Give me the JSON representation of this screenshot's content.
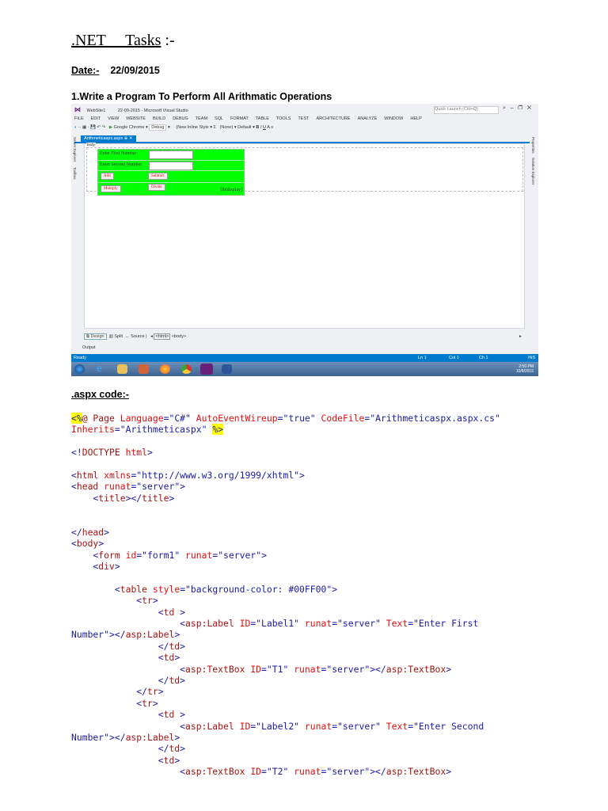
{
  "doc": {
    "title": ".NET     Tasks",
    "title_suffix": " :-",
    "date_label": "Date:-",
    "date_value": "22/09/2015",
    "task": "1.Write a Program To Perform All Arithmatic Operations",
    "code_heading": ".aspx  code:-"
  },
  "vs": {
    "project": "WebSite1",
    "window_title": "22-09-2015 - Microsoft Visual Studio",
    "quick_launch": "Quick Launch (Ctrl+Q)",
    "menu": [
      "FILE",
      "EDIT",
      "VIEW",
      "WEBSITE",
      "BUILD",
      "DEBUG",
      "TEAM",
      "SQL",
      "FORMAT",
      "TABLE",
      "TOOLS",
      "TEST",
      "ARCHITECTURE",
      "ANALYZE",
      "WINDOW",
      "HELP"
    ],
    "toolbar": {
      "browser": "Google Chrome",
      "config": "Debug",
      "style": "(New Inline Style",
      "target": "(None)",
      "font": "Default"
    },
    "tab": "Arithmeticaspx.aspx",
    "body_tag": "body",
    "form": {
      "label1": "Enter First Number",
      "label2": "Enter Second Number",
      "add": "Add",
      "subtract": "Subtract",
      "multiply": "Multiply",
      "divide": "Divide",
      "display": "[lbldisplay]"
    },
    "side_left": [
      "Server Explorer",
      "Toolbox"
    ],
    "side_right": [
      "Properties",
      "Solution Explorer"
    ],
    "views": [
      "Design",
      "Split",
      "Source"
    ],
    "crumbs": [
      "<html>",
      "<body>"
    ],
    "output": "Output",
    "status": {
      "ready": "Ready",
      "ln": "Ln 1",
      "col": "Col 1",
      "ch": "Ch 1",
      "ins": "INS"
    },
    "clock": {
      "time": "2:50 PM",
      "date": "10/8/2015"
    }
  },
  "code": [
    [
      [
        "<%",
        "b y"
      ],
      [
        "@ Page ",
        "m"
      ],
      [
        "Language",
        "r"
      ],
      [
        "=\"C#\" ",
        "b"
      ],
      [
        "AutoEventWireup",
        "r"
      ],
      [
        "=\"true\" ",
        "b"
      ],
      [
        "CodeFile",
        "r"
      ],
      [
        "=\"Arithmeticaspx.aspx.cs\"",
        "b"
      ]
    ],
    [
      [
        "Inherits",
        "r"
      ],
      [
        "=\"Arithmeticaspx\" ",
        "b"
      ],
      [
        "%>",
        "b y"
      ]
    ],
    [],
    [
      [
        "<!",
        "b"
      ],
      [
        "DOCTYPE ",
        "m"
      ],
      [
        "html",
        "r"
      ],
      [
        ">",
        "b"
      ]
    ],
    [],
    [
      [
        "<",
        "b"
      ],
      [
        "html ",
        "m"
      ],
      [
        "xmlns",
        "r"
      ],
      [
        "=\"http://www.w3.org/1999/xhtml\">",
        "b"
      ]
    ],
    [
      [
        "<",
        "b"
      ],
      [
        "head ",
        "m"
      ],
      [
        "runat",
        "r"
      ],
      [
        "=\"server\">",
        "b"
      ]
    ],
    [
      [
        "    <",
        "b"
      ],
      [
        "title",
        "m"
      ],
      [
        "></",
        "b"
      ],
      [
        "title",
        "m"
      ],
      [
        ">",
        "b"
      ]
    ],
    [],
    [],
    [
      [
        "</",
        "b"
      ],
      [
        "head",
        "m"
      ],
      [
        ">",
        "b"
      ]
    ],
    [
      [
        "<",
        "b"
      ],
      [
        "body",
        "m"
      ],
      [
        ">",
        "b"
      ]
    ],
    [
      [
        "    <",
        "b"
      ],
      [
        "form ",
        "m"
      ],
      [
        "id",
        "r"
      ],
      [
        "=\"form1\" ",
        "b"
      ],
      [
        "runat",
        "r"
      ],
      [
        "=\"server\">",
        "b"
      ]
    ],
    [
      [
        "    <",
        "b"
      ],
      [
        "div",
        "m"
      ],
      [
        ">",
        "b"
      ]
    ],
    [],
    [
      [
        "        <",
        "b"
      ],
      [
        "table ",
        "m"
      ],
      [
        "style",
        "r"
      ],
      [
        "=\"background-color: ",
        "b"
      ],
      [
        "#00FF00",
        "b"
      ],
      [
        "\">",
        "b"
      ]
    ],
    [
      [
        "            <",
        "b"
      ],
      [
        "tr",
        "m"
      ],
      [
        ">",
        "b"
      ]
    ],
    [
      [
        "                <",
        "b"
      ],
      [
        "td ",
        "m"
      ],
      [
        ">",
        "b"
      ]
    ],
    [
      [
        "                    <",
        "b"
      ],
      [
        "asp:Label ",
        "m"
      ],
      [
        "ID",
        "r"
      ],
      [
        "=\"Label1\" ",
        "b"
      ],
      [
        "runat",
        "r"
      ],
      [
        "=\"server\" ",
        "b"
      ],
      [
        "Text",
        "r"
      ],
      [
        "=\"Enter First",
        "b"
      ]
    ],
    [
      [
        "Number\"></",
        "b"
      ],
      [
        "asp:Label",
        "m"
      ],
      [
        ">",
        "b"
      ]
    ],
    [
      [
        "                </",
        "b"
      ],
      [
        "td",
        "m"
      ],
      [
        ">",
        "b"
      ]
    ],
    [
      [
        "                <",
        "b"
      ],
      [
        "td",
        "m"
      ],
      [
        ">",
        "b"
      ]
    ],
    [
      [
        "                    <",
        "b"
      ],
      [
        "asp:TextBox ",
        "m"
      ],
      [
        "ID",
        "r"
      ],
      [
        "=\"T1\" ",
        "b"
      ],
      [
        "runat",
        "r"
      ],
      [
        "=\"server\"></",
        "b"
      ],
      [
        "asp:TextBox",
        "m"
      ],
      [
        ">",
        "b"
      ]
    ],
    [
      [
        "                </",
        "b"
      ],
      [
        "td",
        "m"
      ],
      [
        ">",
        "b"
      ]
    ],
    [
      [
        "            </",
        "b"
      ],
      [
        "tr",
        "m"
      ],
      [
        ">",
        "b"
      ]
    ],
    [
      [
        "            <",
        "b"
      ],
      [
        "tr",
        "m"
      ],
      [
        ">",
        "b"
      ]
    ],
    [
      [
        "                <",
        "b"
      ],
      [
        "td ",
        "m"
      ],
      [
        ">",
        "b"
      ]
    ],
    [
      [
        "                    <",
        "b"
      ],
      [
        "asp:Label ",
        "m"
      ],
      [
        "ID",
        "r"
      ],
      [
        "=\"Label2\" ",
        "b"
      ],
      [
        "runat",
        "r"
      ],
      [
        "=\"server\" ",
        "b"
      ],
      [
        "Text",
        "r"
      ],
      [
        "=\"Enter Second",
        "b"
      ]
    ],
    [
      [
        "Number\"></",
        "b"
      ],
      [
        "asp:Label",
        "m"
      ],
      [
        ">",
        "b"
      ]
    ],
    [
      [
        "                </",
        "b"
      ],
      [
        "td",
        "m"
      ],
      [
        ">",
        "b"
      ]
    ],
    [
      [
        "                <",
        "b"
      ],
      [
        "td",
        "m"
      ],
      [
        ">",
        "b"
      ]
    ],
    [
      [
        "                    <",
        "b"
      ],
      [
        "asp:TextBox ",
        "m"
      ],
      [
        "ID",
        "r"
      ],
      [
        "=\"T2\" ",
        "b"
      ],
      [
        "runat",
        "r"
      ],
      [
        "=\"server\"></",
        "b"
      ],
      [
        "asp:TextBox",
        "m"
      ],
      [
        ">",
        "b"
      ]
    ]
  ]
}
